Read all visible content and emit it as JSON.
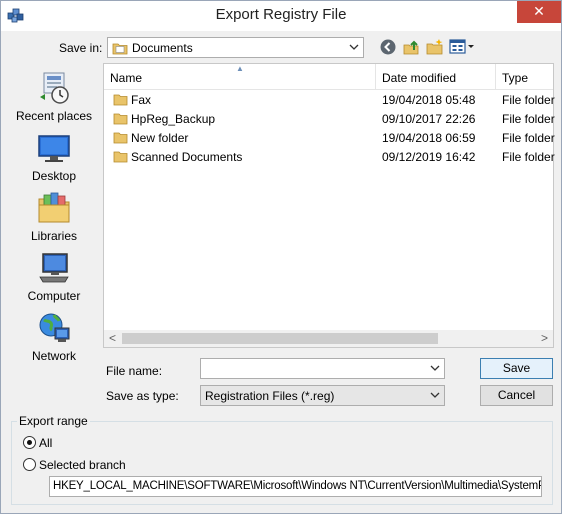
{
  "window": {
    "title": "Export Registry File",
    "close_label": "✕"
  },
  "savein": {
    "label": "Save in:",
    "value": "Documents"
  },
  "toolbar": {
    "icons": [
      "back-icon",
      "up-folder-icon",
      "new-folder-icon",
      "view-menu-icon"
    ]
  },
  "places": [
    {
      "label": "Recent places",
      "icon": "recent-places-icon"
    },
    {
      "label": "Desktop",
      "icon": "desktop-icon"
    },
    {
      "label": "Libraries",
      "icon": "libraries-icon"
    },
    {
      "label": "Computer",
      "icon": "computer-icon"
    },
    {
      "label": "Network",
      "icon": "network-icon"
    }
  ],
  "list": {
    "columns": [
      "Name",
      "Date modified",
      "Type"
    ],
    "rows": [
      {
        "name": "Fax",
        "date": "19/04/2018 05:48",
        "type": "File folder"
      },
      {
        "name": "HpReg_Backup",
        "date": "09/10/2017 22:26",
        "type": "File folder"
      },
      {
        "name": "New folder",
        "date": "19/04/2018 06:59",
        "type": "File folder"
      },
      {
        "name": "Scanned Documents",
        "date": "09/12/2019 16:42",
        "type": "File folder"
      }
    ],
    "scroll_left": "<",
    "scroll_right": ">"
  },
  "filename": {
    "label": "File name:",
    "value": ""
  },
  "savetype": {
    "label": "Save as type:",
    "value": "Registration Files (*.reg)"
  },
  "buttons": {
    "save": "Save",
    "cancel": "Cancel"
  },
  "export_range": {
    "title": "Export range",
    "all_label": "All",
    "branch_label": "Selected branch",
    "selected": "All",
    "branch_path": "HKEY_LOCAL_MACHINE\\SOFTWARE\\Microsoft\\Windows NT\\CurrentVersion\\Multimedia\\SystemPro"
  }
}
